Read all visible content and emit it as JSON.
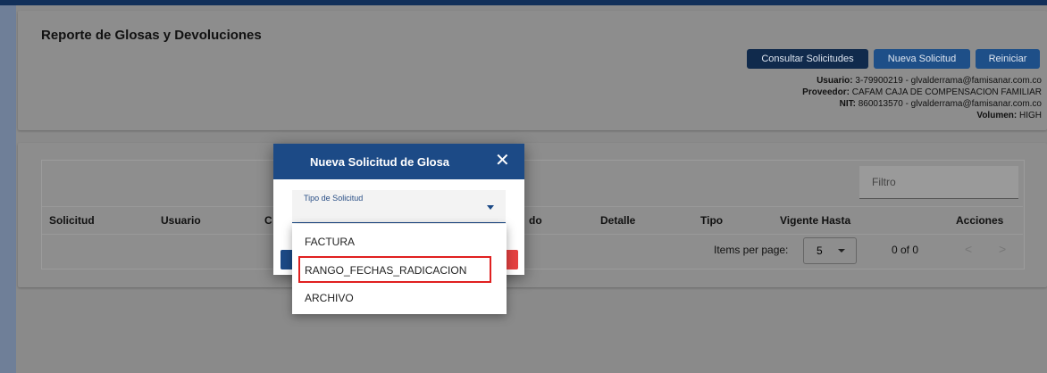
{
  "page": {
    "title": "Reporte de Glosas y Devoluciones"
  },
  "toolbar": {
    "consultar_label": "Consultar Solicitudes",
    "nueva_label": "Nueva Solicitud",
    "reiniciar_label": "Reiniciar"
  },
  "user_info": {
    "usuario_key": "Usuario:",
    "usuario_value": "3-79900219 - glvalderrama@famisanar.com.co",
    "proveedor_key": "Proveedor:",
    "proveedor_value": "CAFAM CAJA DE COMPENSACION FAMILIAR",
    "nit_key": "NIT:",
    "nit_value": "860013570 - glvalderrama@famisanar.com.co",
    "volumen_key": "Volumen:",
    "volumen_value": "HIGH"
  },
  "table": {
    "filter_placeholder": "Filtro",
    "headers": [
      "Solicitud",
      "Usuario",
      "C",
      "do",
      "Detalle",
      "Tipo",
      "Vigente Hasta",
      "Acciones"
    ]
  },
  "paginator": {
    "items_label": "Items per page:",
    "page_size": "5",
    "range": "0 of 0",
    "prev": "<",
    "next": ">"
  },
  "dialog": {
    "title": "Nueva Solicitud de Glosa",
    "close_symbol": "✕",
    "field_label": "Tipo de Solicitud"
  },
  "dropdown": {
    "options": [
      "FACTURA",
      "RANGO_FECHAS_RADICACION",
      "ARCHIVO"
    ],
    "highlighted": "RANGO_FECHAS_RADICACION"
  },
  "colors": {
    "header_navy": "#12305a",
    "dialog_header": "#1c4a86",
    "highlight_outline": "#e02020",
    "cancel_red": "#e54242"
  }
}
